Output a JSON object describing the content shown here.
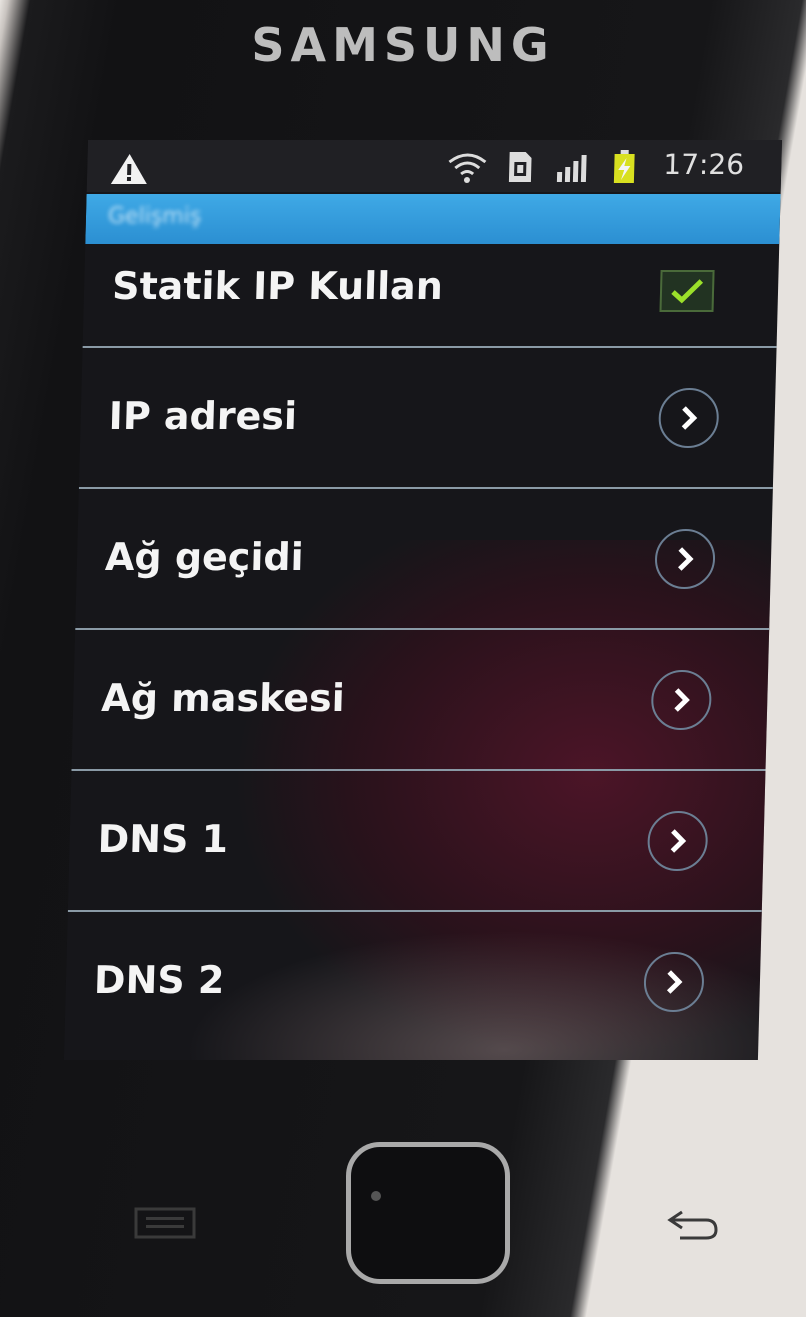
{
  "device": {
    "brand": "SAMSUNG"
  },
  "status_bar": {
    "time": "17:26",
    "icons": [
      "warning-icon",
      "wifi-icon",
      "sim-icon",
      "signal-icon",
      "battery-charging-icon"
    ]
  },
  "title_bar": {
    "title": "Gelişmiş"
  },
  "settings": {
    "items": [
      {
        "label": "Statik IP Kullan",
        "control": "checkbox",
        "checked": true
      },
      {
        "label": "IP adresi",
        "control": "chevron-right-icon"
      },
      {
        "label": "Ağ geçidi",
        "control": "chevron-right-icon"
      },
      {
        "label": "Ağ maskesi",
        "control": "chevron-right-icon"
      },
      {
        "label": "DNS 1",
        "control": "chevron-right-icon"
      },
      {
        "label": "DNS 2",
        "control": "chevron-right-icon"
      }
    ]
  },
  "colors": {
    "title_bar_blue": "#2b8fd2",
    "checkmark_green": "#9be02a",
    "text_white": "#f4f4f4"
  }
}
